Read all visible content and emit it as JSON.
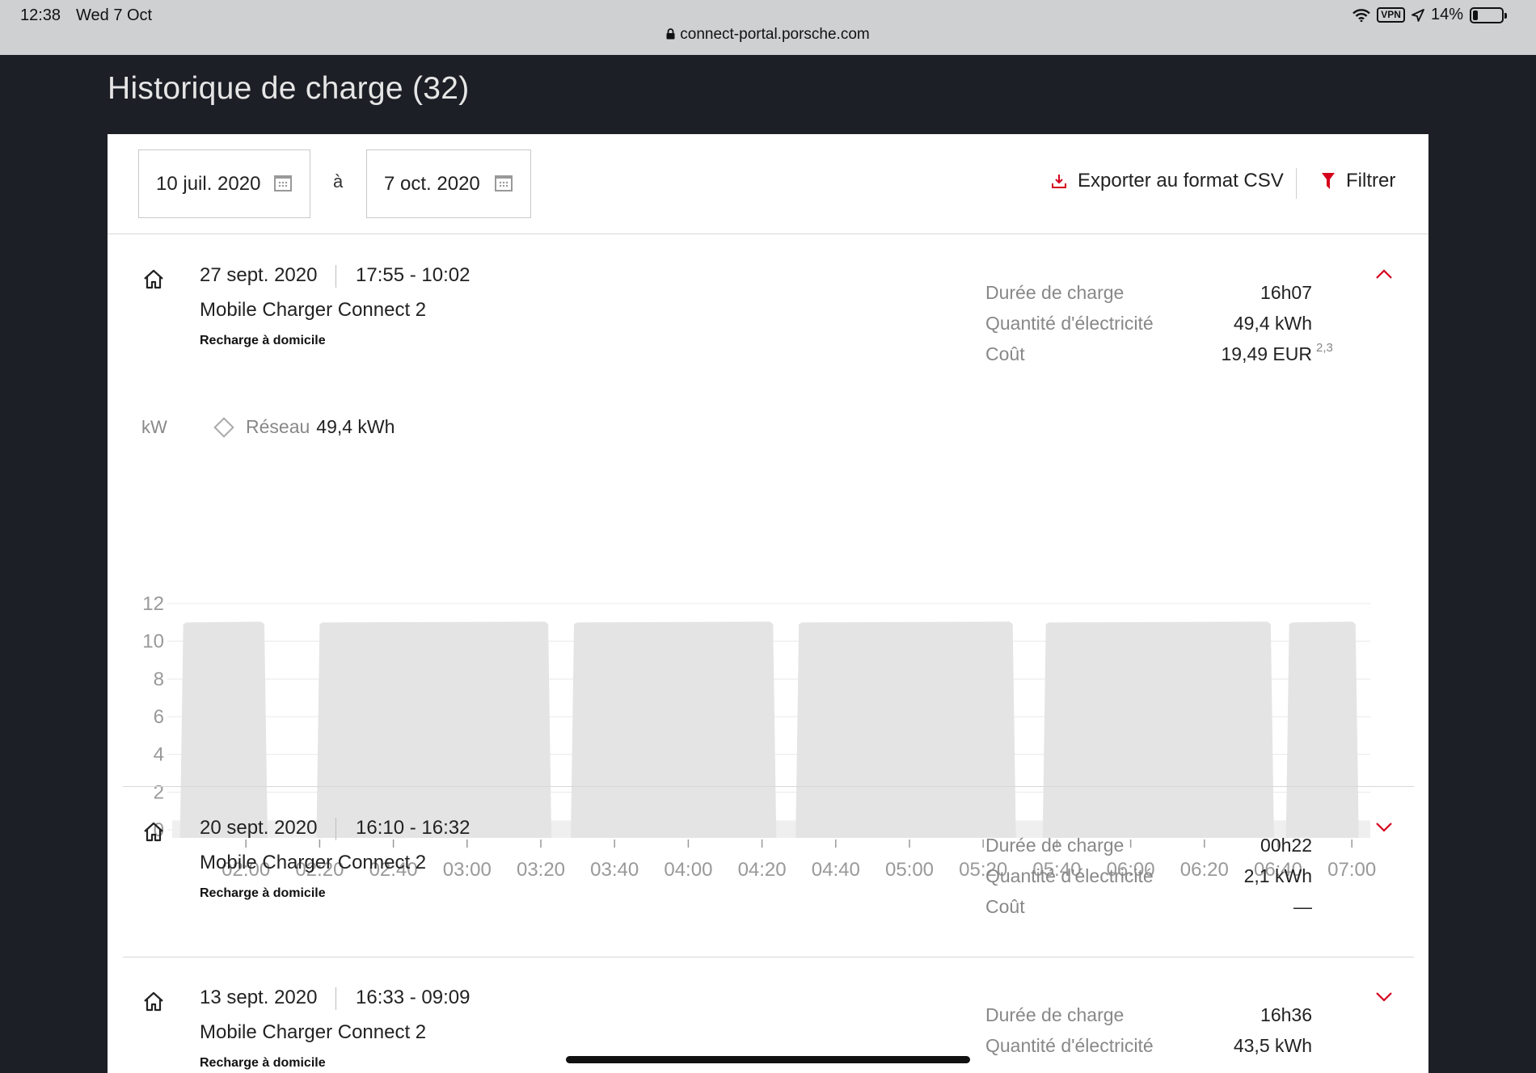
{
  "status_bar": {
    "time": "12:38",
    "date": "Wed 7 Oct",
    "url": "connect-portal.porsche.com",
    "vpn": "VPN",
    "battery": "14%"
  },
  "page": {
    "title": "Historique de charge (32)"
  },
  "toolbar": {
    "date_from": "10 juil. 2020",
    "separator": "à",
    "date_to": "7 oct. 2020",
    "export_label": "Exporter au format CSV",
    "filter_label": "Filtrer"
  },
  "accent_color": "#d5001c",
  "sessions": [
    {
      "date": "27 sept. 2020",
      "time_range": "17:55 - 10:02",
      "device": "Mobile Charger Connect 2",
      "type": "Recharge à domicile",
      "duration_label": "Durée de charge",
      "duration": "16h07",
      "energy_label": "Quantité d'électricité",
      "energy": "49,4 kWh",
      "cost_label": "Coût",
      "cost": "19,49 EUR",
      "cost_note": "2,3",
      "expanded": true
    },
    {
      "date": "20 sept. 2020",
      "time_range": "16:10 - 16:32",
      "device": "Mobile Charger Connect 2",
      "type": "Recharge à domicile",
      "duration_label": "Durée de charge",
      "duration": "00h22",
      "energy_label": "Quantité d'électricité",
      "energy": "2,1 kWh",
      "cost_label": "Coût",
      "cost": "—",
      "expanded": false
    },
    {
      "date": "13 sept. 2020",
      "time_range": "16:33 - 09:09",
      "device": "Mobile Charger Connect 2",
      "type": "Recharge à domicile",
      "duration_label": "Durée de charge",
      "duration": "16h36",
      "energy_label": "Quantité d'électricité",
      "energy": "43,5 kWh",
      "expanded": false
    }
  ],
  "chart_data": {
    "type": "area",
    "ylabel": "kW",
    "legend": [
      {
        "name": "Réseau",
        "value": "49,4 kWh"
      }
    ],
    "ylim": [
      0,
      12
    ],
    "yticks": [
      0,
      2,
      4,
      6,
      8,
      10,
      12
    ],
    "x_ticks": [
      "02:00",
      "02:20",
      "02:40",
      "03:00",
      "03:20",
      "03:40",
      "04:00",
      "04:20",
      "04:40",
      "05:00",
      "05:20",
      "05:40",
      "06:00",
      "06:20",
      "06:40",
      "07:00"
    ],
    "xlim_minutes": [
      100,
      425
    ],
    "grid": true,
    "color": "#e4e4e4",
    "series": [
      {
        "name": "Réseau",
        "segments": [
          {
            "start": "01:43",
            "end": "02:05",
            "value": 11.0
          },
          {
            "start": "02:20",
            "end": "03:22",
            "value": 11.0
          },
          {
            "start": "03:29",
            "end": "04:23",
            "value": 11.0
          },
          {
            "start": "04:30",
            "end": "05:28",
            "value": 11.0
          },
          {
            "start": "05:37",
            "end": "06:38",
            "value": 11.0
          },
          {
            "start": "06:43",
            "end": "07:01",
            "value": 11.0
          }
        ],
        "baseline": 0.5
      }
    ]
  }
}
